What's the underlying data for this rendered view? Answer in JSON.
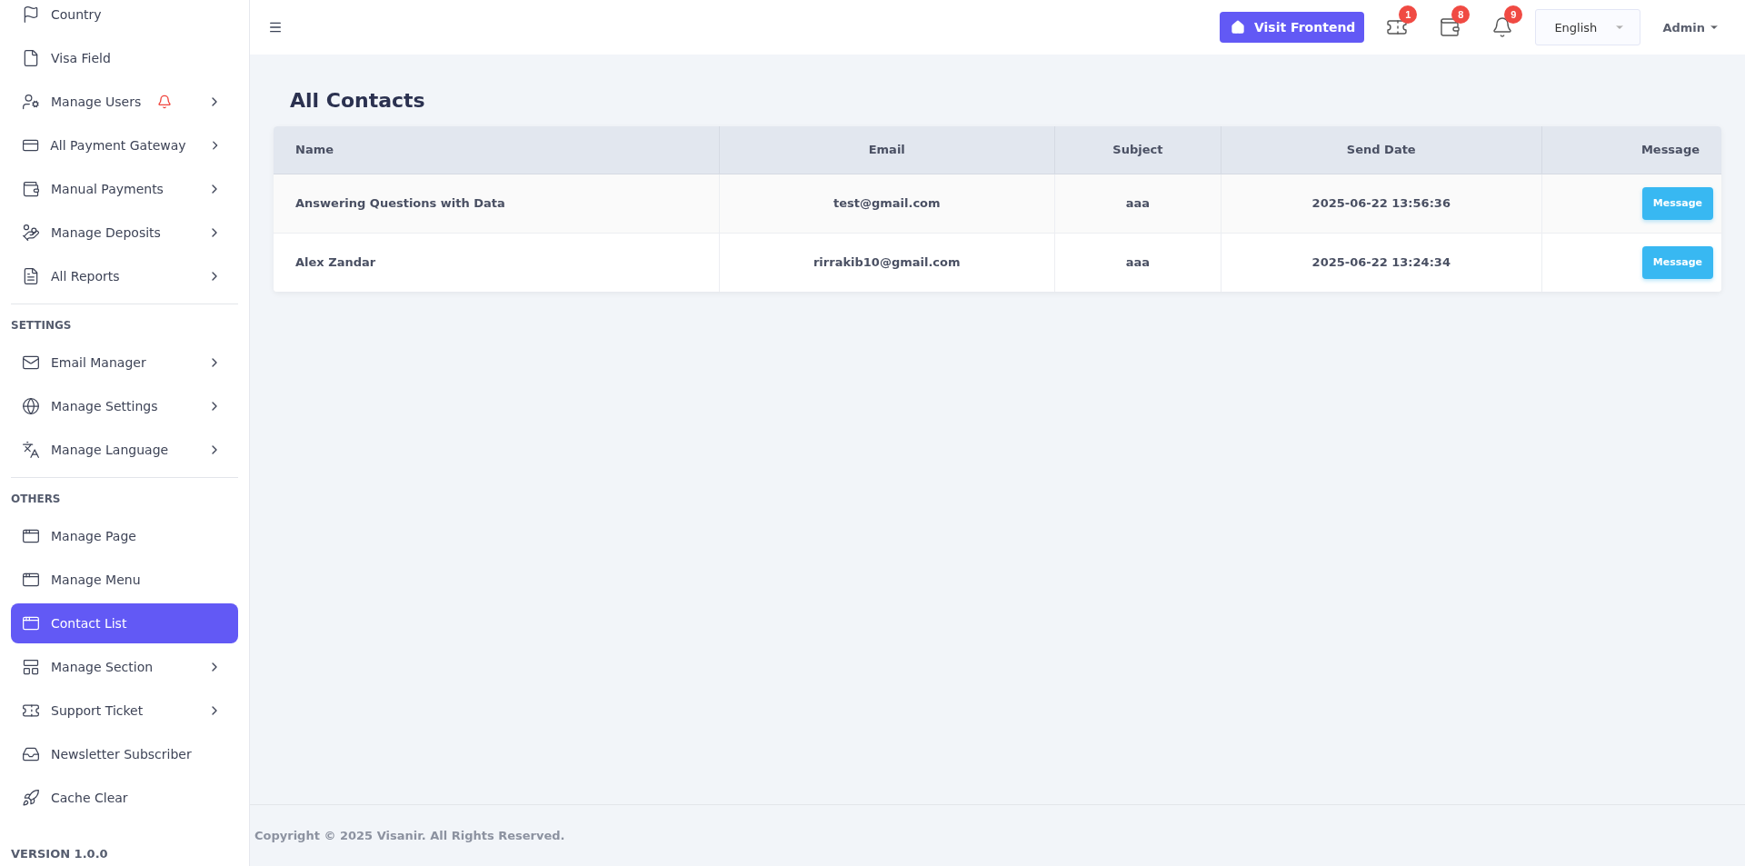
{
  "sidebar": {
    "groups": [
      {
        "items": [
          {
            "label": "Country",
            "selected": false,
            "has_submenu": false,
            "alert": false
          },
          {
            "label": "Visa Field",
            "selected": false,
            "has_submenu": false,
            "alert": false
          },
          {
            "label": "Manage Users",
            "selected": false,
            "has_submenu": true,
            "alert": true
          },
          {
            "label": "All Payment Gateway",
            "selected": false,
            "has_submenu": true,
            "alert": false
          },
          {
            "label": "Manual Payments",
            "selected": false,
            "has_submenu": true,
            "alert": false
          },
          {
            "label": "Manage Deposits",
            "selected": false,
            "has_submenu": true,
            "alert": false
          },
          {
            "label": "All Reports",
            "selected": false,
            "has_submenu": true,
            "alert": false
          }
        ]
      },
      {
        "heading": "SETTINGS",
        "items": [
          {
            "label": "Email Manager",
            "selected": false,
            "has_submenu": true,
            "alert": false
          },
          {
            "label": "Manage Settings",
            "selected": false,
            "has_submenu": true,
            "alert": false
          },
          {
            "label": "Manage Language",
            "selected": false,
            "has_submenu": true,
            "alert": false
          }
        ]
      },
      {
        "heading": "OTHERS",
        "items": [
          {
            "label": "Manage Page",
            "selected": false,
            "has_submenu": false,
            "alert": false
          },
          {
            "label": "Manage Menu",
            "selected": false,
            "has_submenu": false,
            "alert": false
          },
          {
            "label": "Contact List",
            "selected": true,
            "has_submenu": false,
            "alert": false
          },
          {
            "label": "Manage Section",
            "selected": false,
            "has_submenu": true,
            "alert": false
          },
          {
            "label": "Support Ticket",
            "selected": false,
            "has_submenu": true,
            "alert": false
          },
          {
            "label": "Newsletter Subscriber",
            "selected": false,
            "has_submenu": false,
            "alert": false
          },
          {
            "label": "Cache Clear",
            "selected": false,
            "has_submenu": false,
            "alert": false
          }
        ]
      }
    ],
    "version": "VERSION 1.0.0"
  },
  "topbar": {
    "visit_button": "Visit Frontend",
    "badges": [
      "1",
      "8",
      "9"
    ],
    "language": "English",
    "user": "Admin"
  },
  "page": {
    "title": "All Contacts",
    "table": {
      "columns": [
        "Name",
        "Email",
        "Subject",
        "Send Date",
        "Message"
      ],
      "rows": [
        {
          "name": "Answering Questions with Data",
          "email": "test@gmail.com",
          "subject": "aaa",
          "date": "2025-06-22 13:56:36",
          "action": "Message"
        },
        {
          "name": "Alex Zandar",
          "email": "rirrakib10@gmail.com",
          "subject": "aaa",
          "date": "2025-06-22 13:24:34",
          "action": "Message"
        }
      ]
    }
  },
  "footer": "Copyright © 2025 Visanir. All Rights Reserved."
}
